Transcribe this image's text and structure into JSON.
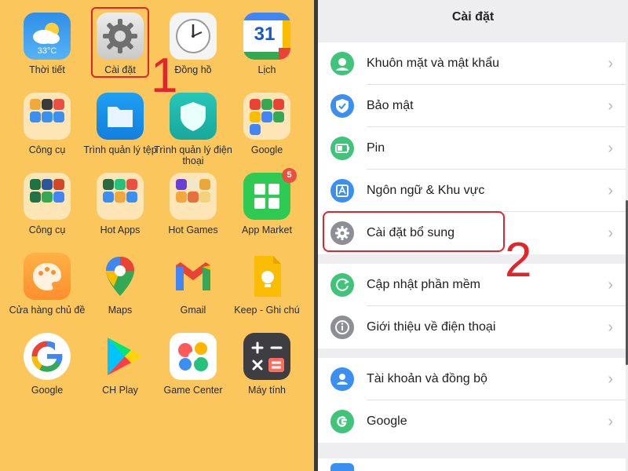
{
  "home": {
    "apps": [
      {
        "label": "Thời tiết",
        "icon": "weather-icon",
        "temp": "33°C"
      },
      {
        "label": "Cài đặt",
        "icon": "settings-gear-icon"
      },
      {
        "label": "Đồng hồ",
        "icon": "clock-icon"
      },
      {
        "label": "Lịch",
        "icon": "calendar-icon",
        "day": "31"
      },
      {
        "label": "Công cụ",
        "icon": "tools-folder-icon"
      },
      {
        "label": "Trình quản lý tệp",
        "icon": "file-manager-icon"
      },
      {
        "label": "Trình quản lý điện thoại",
        "icon": "phone-manager-icon"
      },
      {
        "label": "Google",
        "icon": "google-folder-icon"
      },
      {
        "label": "Công cụ",
        "icon": "office-folder-icon"
      },
      {
        "label": "Hot Apps",
        "icon": "hot-apps-folder-icon"
      },
      {
        "label": "Hot Games",
        "icon": "hot-games-folder-icon"
      },
      {
        "label": "App Market",
        "icon": "app-market-icon",
        "badge": "5"
      },
      {
        "label": "Cửa hàng chủ đề",
        "icon": "theme-store-icon"
      },
      {
        "label": "Maps",
        "icon": "maps-icon"
      },
      {
        "label": "Gmail",
        "icon": "gmail-icon"
      },
      {
        "label": "Keep - Ghi chú",
        "icon": "keep-notes-icon"
      },
      {
        "label": "Google",
        "icon": "google-icon"
      },
      {
        "label": "CH Play",
        "icon": "play-store-icon"
      },
      {
        "label": "Game Center",
        "icon": "game-center-icon"
      },
      {
        "label": "Máy tính",
        "icon": "calculator-icon"
      }
    ],
    "step1": "1"
  },
  "settings": {
    "title": "Cài đặt",
    "groups": [
      {
        "items": [
          {
            "label": "Khuôn mặt và mật khẩu",
            "icon": "face-password-icon",
            "color": "#3fc47a"
          },
          {
            "label": "Bảo mật",
            "icon": "shield-check-icon",
            "color": "#3a8ff0"
          },
          {
            "label": "Pin",
            "icon": "battery-icon",
            "color": "#3fc47a"
          },
          {
            "label": "Ngôn ngữ & Khu vực",
            "icon": "language-icon",
            "color": "#3a8ff0"
          },
          {
            "label": "Cài đặt bổ sung",
            "icon": "gear-icon",
            "color": "#8e8e96"
          }
        ]
      },
      {
        "items": [
          {
            "label": "Cập nhật phần mềm",
            "icon": "update-icon",
            "color": "#3fc47a"
          },
          {
            "label": "Giới thiệu về điện thoại",
            "icon": "info-icon",
            "color": "#8e8e96"
          }
        ]
      },
      {
        "items": [
          {
            "label": "Tài khoản và đồng bộ",
            "icon": "account-icon",
            "color": "#3a8ff0"
          },
          {
            "label": "Google",
            "icon": "google-g-icon",
            "color": "#3fc47a"
          }
        ]
      }
    ],
    "step2": "2",
    "chevron": "›"
  }
}
